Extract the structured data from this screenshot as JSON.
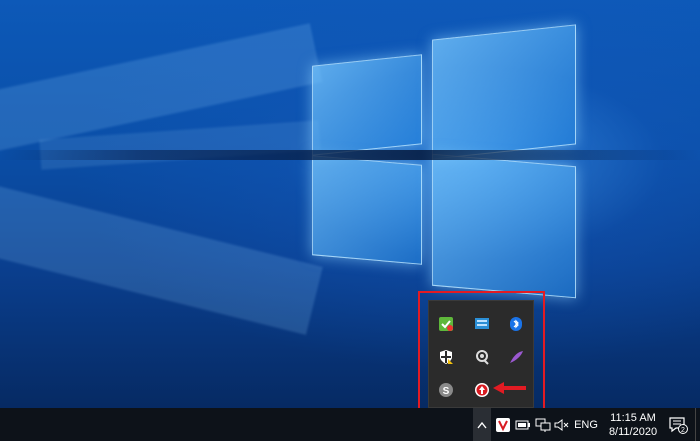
{
  "desktop": {
    "wallpaper": "windows-10-hero-logo",
    "accent": "#0a4fa8"
  },
  "tray_popup": {
    "icons": [
      {
        "name": "nvidia-vpn-icon",
        "row": 0,
        "col": 0
      },
      {
        "name": "network-monitor-icon",
        "row": 0,
        "col": 1
      },
      {
        "name": "bluetooth-icon",
        "row": 0,
        "col": 2
      },
      {
        "name": "windows-security-icon",
        "row": 1,
        "col": 0
      },
      {
        "name": "headset-app-icon",
        "row": 1,
        "col": 1
      },
      {
        "name": "feather-app-icon",
        "row": 1,
        "col": 2
      },
      {
        "name": "skype-icon",
        "row": 2,
        "col": 0
      },
      {
        "name": "red-shield-app-icon",
        "row": 2,
        "col": 1
      }
    ],
    "highlight_color": "#e21b23"
  },
  "taskbar": {
    "show_hidden_icons": "^",
    "language": "ENG",
    "time": "11:15 AM",
    "date": "8/11/2020",
    "notification_count": "2",
    "tray_icons": [
      "vivaldi-icon",
      "battery-icon",
      "network-icon",
      "volume-muted-icon"
    ]
  }
}
